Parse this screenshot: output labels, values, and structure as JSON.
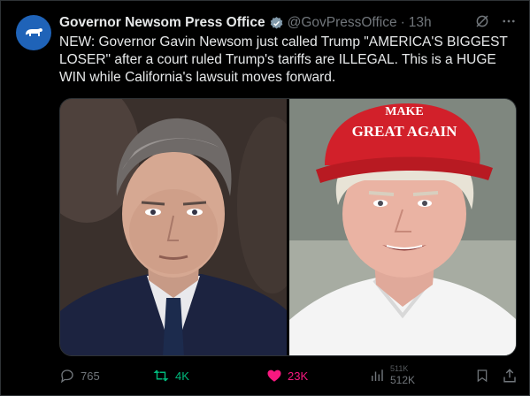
{
  "tweet": {
    "author_name": "Governor Newsom Press Office",
    "handle": "@GovPressOffice",
    "separator": "·",
    "time": "13h",
    "text": "NEW: Governor Gavin Newsom just called Trump \"AMERICA'S BIGGEST LOSER\" after a court ruled Trump's tariffs are ILLEGAL. This is a HUGE WIN while California's lawsuit moves forward.",
    "hat_text": "GREAT AGAIN",
    "hat_text_top": "MAKE",
    "colors": {
      "accent_blue": "#1d9bf0",
      "retweet_green": "#00ba7c",
      "like_pink": "#f91880",
      "muted": "#71767b"
    }
  },
  "actions": {
    "replies": "765",
    "retweets": "4K",
    "likes": "23K",
    "views_prev": "511K",
    "views": "512K"
  }
}
